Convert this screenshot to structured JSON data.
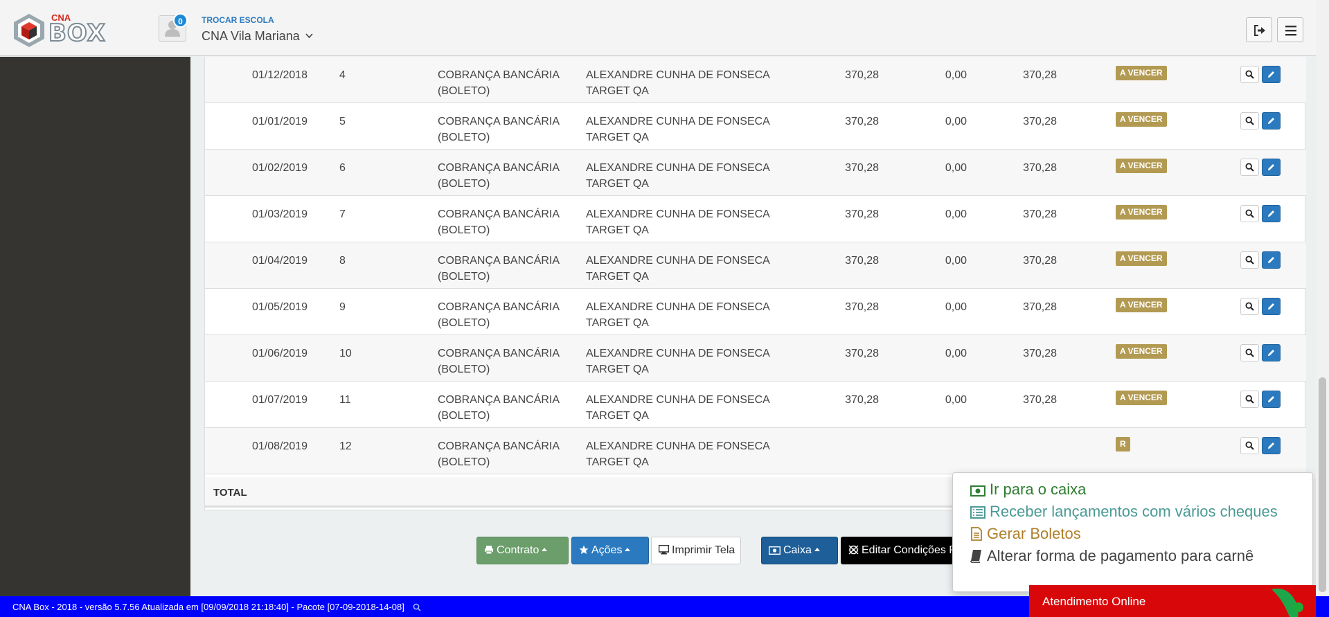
{
  "header": {
    "brand_top": "CNA",
    "brand_main": "BOX",
    "notification_count": "0",
    "switch_school_label": "TROCAR ESCOLA",
    "school_name": "CNA Vila Mariana"
  },
  "table": {
    "status_badge": "A VENCER",
    "rows": [
      {
        "date": "01/12/2018",
        "num": "4",
        "type1": "COBRANÇA BANCÁRIA",
        "type2": "(BOLETO)",
        "name1": "ALEXANDRE CUNHA DE FONSECA",
        "name2": "TARGET QA",
        "value": "370,28",
        "discount": "0,00",
        "total": "370,28",
        "status": "A VENCER"
      },
      {
        "date": "01/01/2019",
        "num": "5",
        "type1": "COBRANÇA BANCÁRIA",
        "type2": "(BOLETO)",
        "name1": "ALEXANDRE CUNHA DE FONSECA",
        "name2": "TARGET QA",
        "value": "370,28",
        "discount": "0,00",
        "total": "370,28",
        "status": "A VENCER"
      },
      {
        "date": "01/02/2019",
        "num": "6",
        "type1": "COBRANÇA BANCÁRIA",
        "type2": "(BOLETO)",
        "name1": "ALEXANDRE CUNHA DE FONSECA",
        "name2": "TARGET QA",
        "value": "370,28",
        "discount": "0,00",
        "total": "370,28",
        "status": "A VENCER"
      },
      {
        "date": "01/03/2019",
        "num": "7",
        "type1": "COBRANÇA BANCÁRIA",
        "type2": "(BOLETO)",
        "name1": "ALEXANDRE CUNHA DE FONSECA",
        "name2": "TARGET QA",
        "value": "370,28",
        "discount": "0,00",
        "total": "370,28",
        "status": "A VENCER"
      },
      {
        "date": "01/04/2019",
        "num": "8",
        "type1": "COBRANÇA BANCÁRIA",
        "type2": "(BOLETO)",
        "name1": "ALEXANDRE CUNHA DE FONSECA",
        "name2": "TARGET QA",
        "value": "370,28",
        "discount": "0,00",
        "total": "370,28",
        "status": "A VENCER"
      },
      {
        "date": "01/05/2019",
        "num": "9",
        "type1": "COBRANÇA BANCÁRIA",
        "type2": "(BOLETO)",
        "name1": "ALEXANDRE CUNHA DE FONSECA",
        "name2": "TARGET QA",
        "value": "370,28",
        "discount": "0,00",
        "total": "370,28",
        "status": "A VENCER"
      },
      {
        "date": "01/06/2019",
        "num": "10",
        "type1": "COBRANÇA BANCÁRIA",
        "type2": "(BOLETO)",
        "name1": "ALEXANDRE CUNHA DE FONSECA",
        "name2": "TARGET QA",
        "value": "370,28",
        "discount": "0,00",
        "total": "370,28",
        "status": "A VENCER"
      },
      {
        "date": "01/07/2019",
        "num": "11",
        "type1": "COBRANÇA BANCÁRIA",
        "type2": "(BOLETO)",
        "name1": "ALEXANDRE CUNHA DE FONSECA",
        "name2": "TARGET QA",
        "value": "370,28",
        "discount": "0,00",
        "total": "370,28",
        "status": "A VENCER"
      },
      {
        "date": "01/08/2019",
        "num": "12",
        "type1": "COBRANÇA BANCÁRIA",
        "type2": "(BOLETO)",
        "name1": "ALEXANDRE CUNHA DE FONSECA",
        "name2": "TARGET QA",
        "value": "",
        "discount": "",
        "total": "",
        "status": "R"
      }
    ],
    "total_label": "TOTAL"
  },
  "actions": {
    "contrato": "Contrato",
    "acoes": "Ações",
    "imprimir": "Imprimir Tela",
    "caixa": "Caixa",
    "editar": "Editar Condições Pagamento"
  },
  "caixa_menu": {
    "items": [
      {
        "label": "Ir para o caixa",
        "color": "#2e7d32",
        "icon": "money-icon"
      },
      {
        "label": "Receber lançamentos com vários cheques",
        "color": "#4a9a96",
        "icon": "list-icon"
      },
      {
        "label": "Gerar Boletos",
        "color": "#b07f2a",
        "icon": "file-icon"
      },
      {
        "label": "Alterar forma de pagamento para carnê",
        "color": "#444444",
        "icon": "book-icon"
      }
    ]
  },
  "footer": {
    "version_text": "CNA Box - 2018 - versão 5.7.56 Atualizada em [09/09/2018 21:18:40] - Pacote [07-09-2018-14-08]"
  },
  "chat": {
    "label": "Atendimento Online"
  },
  "colors": {
    "primary": "#2b7abf",
    "success": "#6b9e6b",
    "badge": "#b39a52",
    "footer": "#0000ff",
    "chat": "#d8080a",
    "sidebar": "#363431"
  }
}
